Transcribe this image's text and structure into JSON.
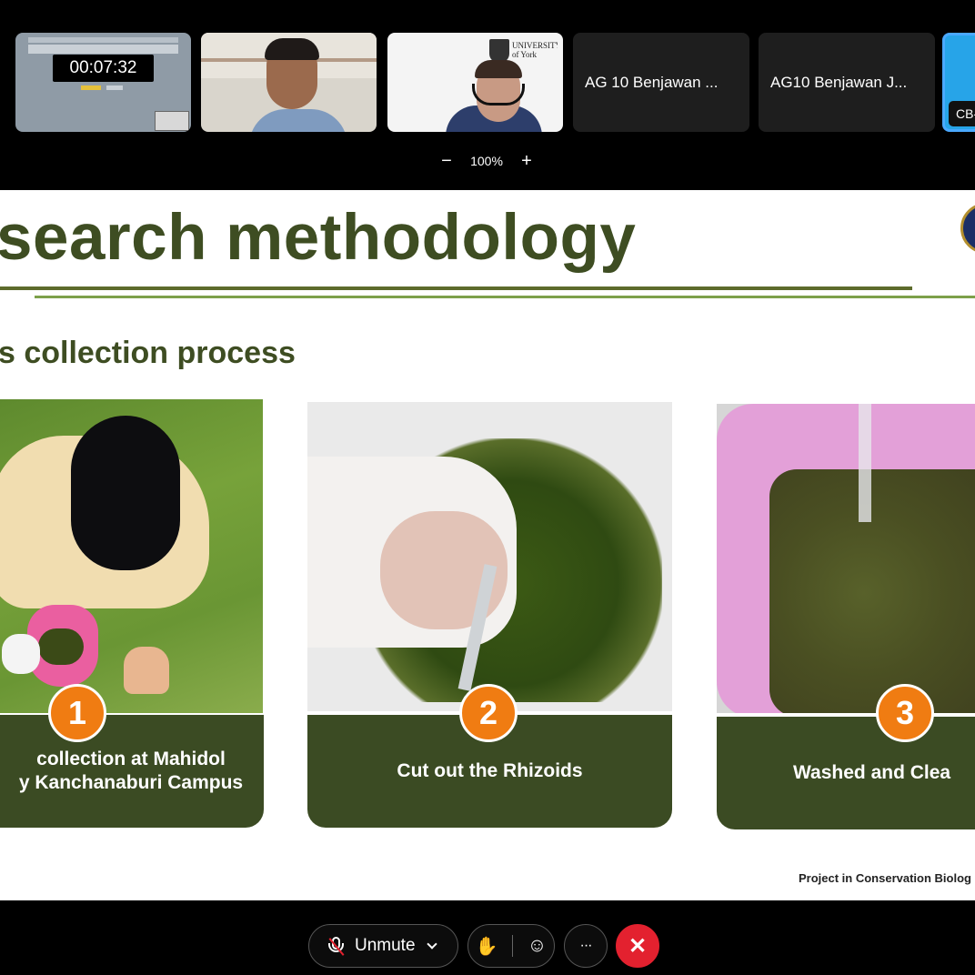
{
  "participants": [
    {
      "name": "",
      "kind": "screen-share",
      "timer": "00:07:32"
    },
    {
      "name": "",
      "kind": "video"
    },
    {
      "name": "",
      "kind": "video",
      "logo_text": "UNIVERSITY of York"
    },
    {
      "name": "AG 10 Benjawan ...",
      "kind": "name-only"
    },
    {
      "name": "AG10 Benjawan J...",
      "kind": "name-only"
    },
    {
      "name": "CB-",
      "kind": "avatar"
    }
  ],
  "zoom": {
    "minus": "−",
    "level": "100%",
    "plus": "+"
  },
  "slide": {
    "title": "search methodology",
    "subtitle": "s collection process",
    "steps": [
      {
        "number": "1",
        "caption_lines": [
          "collection at Mahidol",
          "y Kanchanaburi Campus"
        ]
      },
      {
        "number": "2",
        "caption_lines": [
          "Cut out the Rhizoids"
        ]
      },
      {
        "number": "3",
        "caption_lines": [
          "Washed and Clea"
        ]
      }
    ],
    "footer": "Project in Conservation Biolog"
  },
  "toolbar": {
    "unmute_label": "Unmute",
    "more_label": "···",
    "colors": {
      "leave": "#e3212f",
      "accent_orange": "#f07c12",
      "slide_green": "#3e4d22"
    }
  }
}
